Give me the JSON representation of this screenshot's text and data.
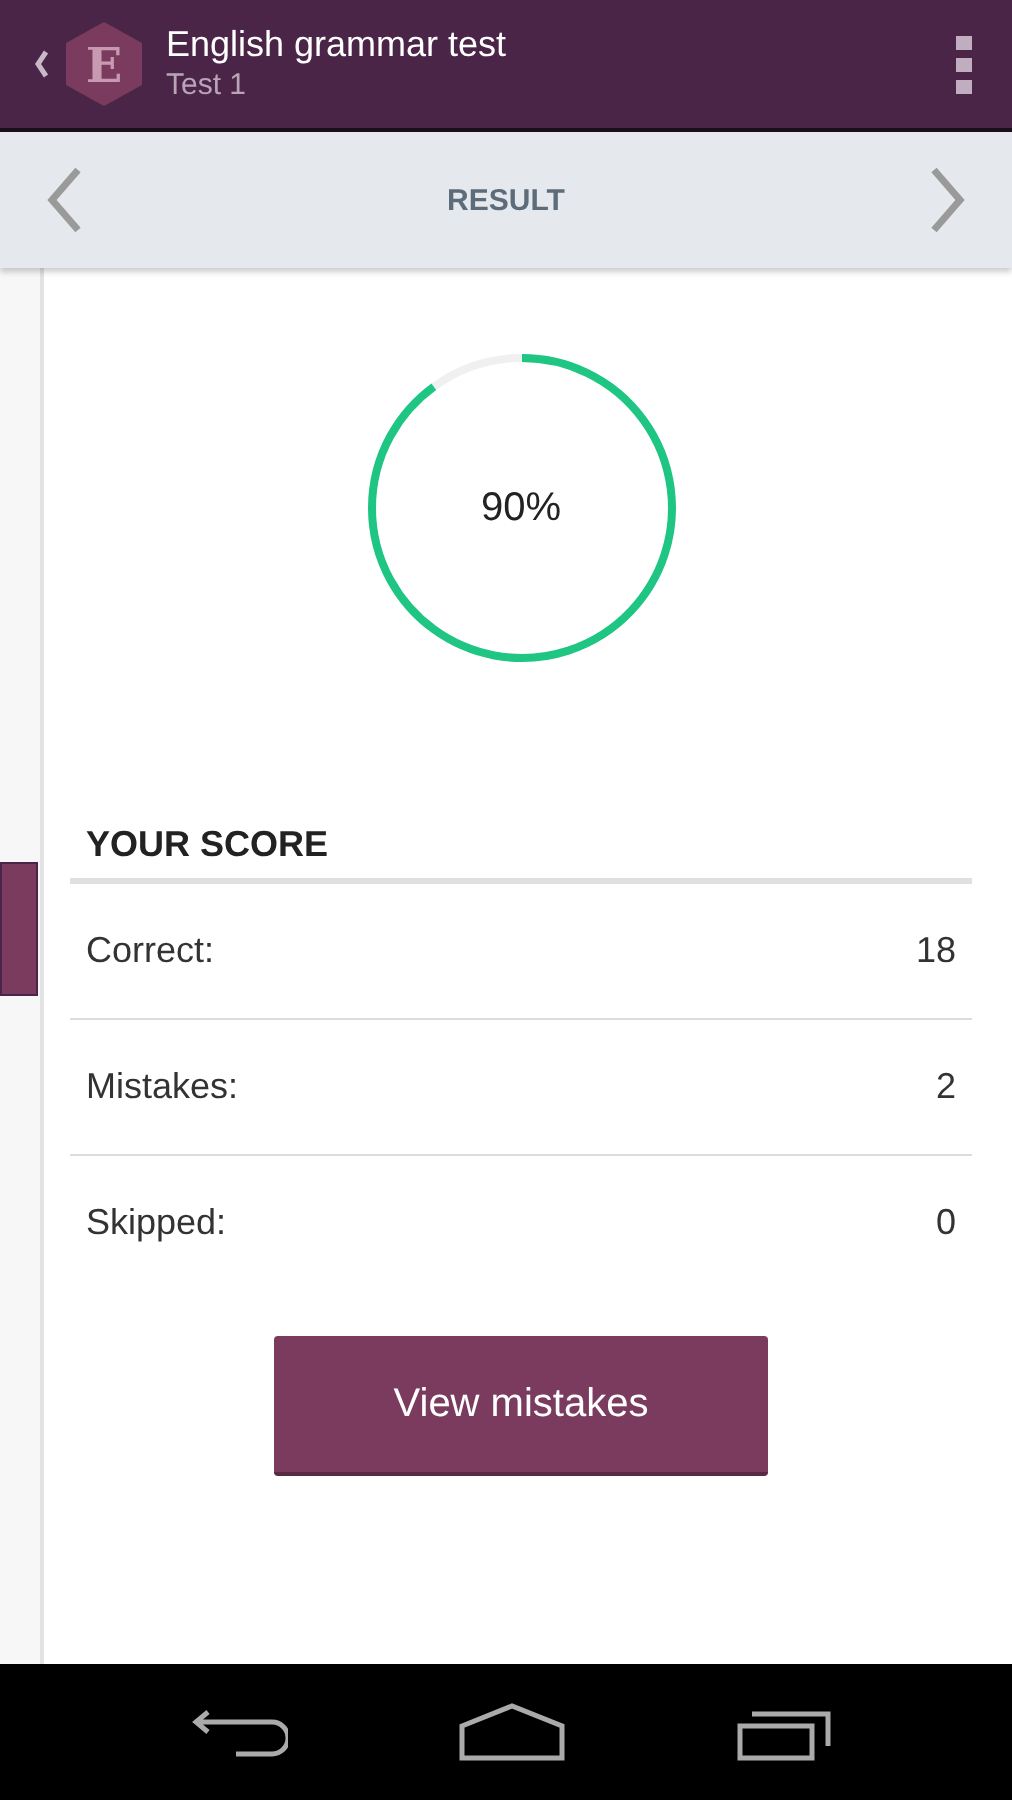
{
  "header": {
    "logo_letter": "E",
    "title": "English grammar test",
    "subtitle": "Test 1"
  },
  "subbar": {
    "title": "RESULT"
  },
  "result": {
    "reading": "90%"
  },
  "score": {
    "heading": "YOUR SCORE",
    "rows": [
      {
        "label": "Correct:",
        "value": "18"
      },
      {
        "label": "Mistakes:",
        "value": "2"
      },
      {
        "label": "Skipped:",
        "value": "0"
      }
    ]
  },
  "button": {
    "label": "View mistakes"
  }
}
